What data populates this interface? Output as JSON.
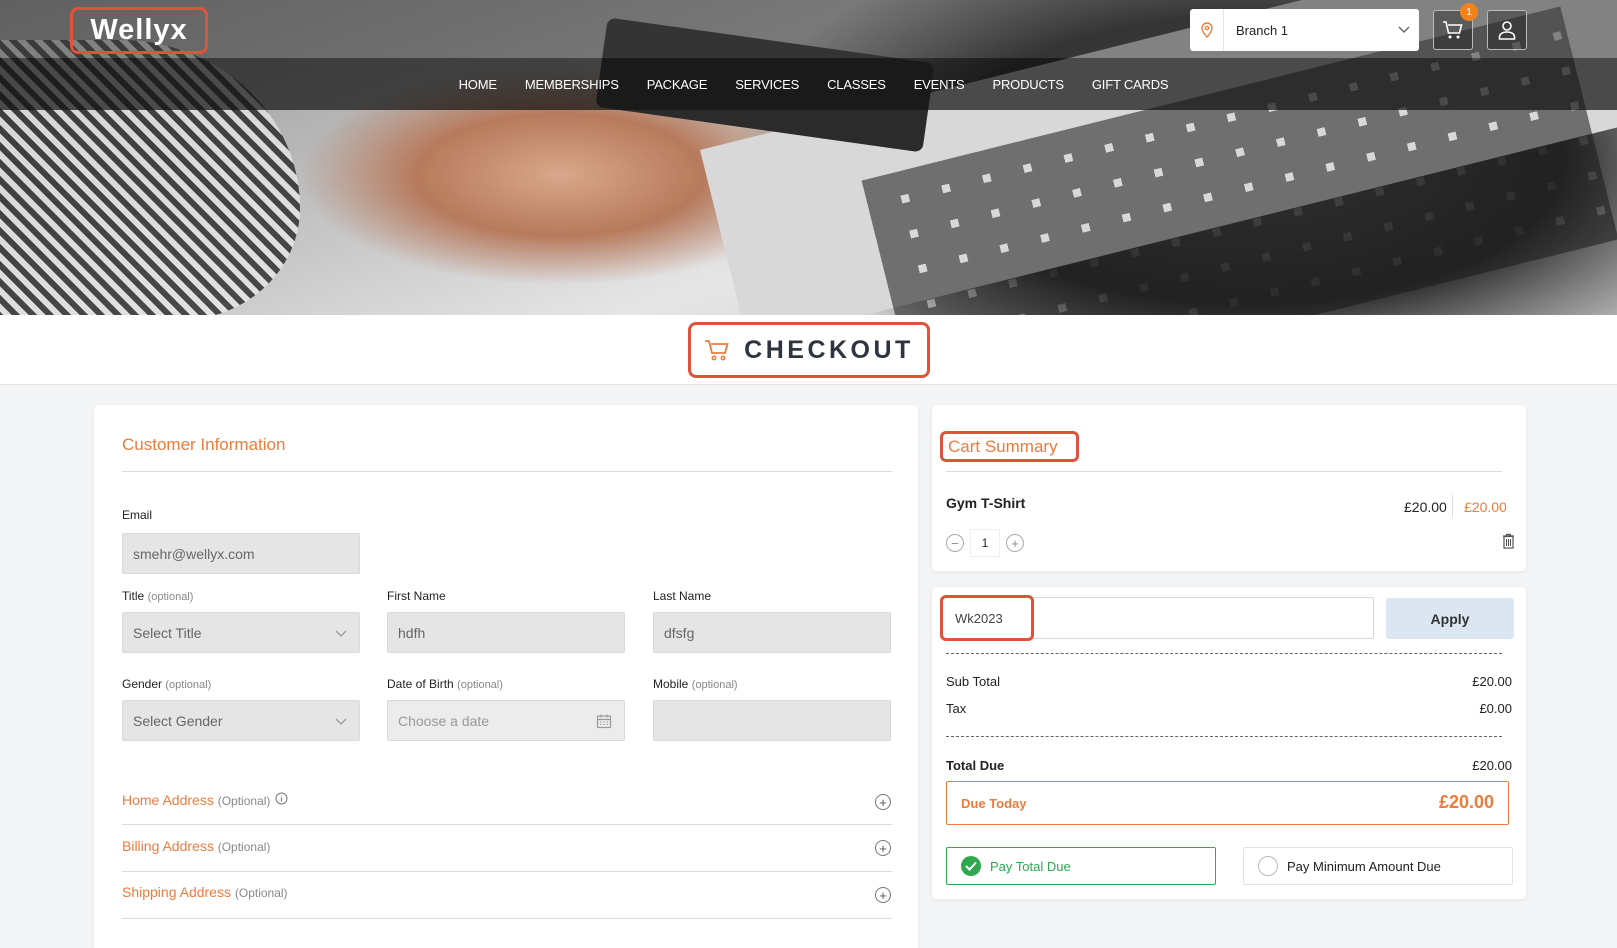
{
  "brand": {
    "logo": "Wellyx"
  },
  "header": {
    "branch": "Branch 1",
    "cart_count": "1",
    "nav": [
      "HOME",
      "MEMBERSHIPS",
      "PACKAGE",
      "SERVICES",
      "CLASSES",
      "EVENTS",
      "PRODUCTS",
      "GIFT CARDS"
    ]
  },
  "page": {
    "title": "CHECKOUT"
  },
  "customer": {
    "section_title": "Customer Information",
    "email_label": "Email",
    "email_value": "smehr@wellyx.com",
    "title_label": "Title",
    "title_opt": "(optional)",
    "title_value": "Select Title",
    "first_name_label": "First Name",
    "first_name_value": "hdfh",
    "last_name_label": "Last Name",
    "last_name_value": "dfsfg",
    "gender_label": "Gender",
    "gender_opt": "(optional)",
    "gender_value": "Select Gender",
    "dob_label": "Date of Birth",
    "dob_opt": "(optional)",
    "dob_placeholder": "Choose a date",
    "mobile_label": "Mobile",
    "mobile_opt": "(optional)",
    "mobile_value": ""
  },
  "addresses": [
    {
      "title": "Home Address",
      "opt": "(Optional)"
    },
    {
      "title": "Billing Address",
      "opt": "(Optional)"
    },
    {
      "title": "Shipping Address",
      "opt": "(Optional)"
    }
  ],
  "cart": {
    "title": "Cart Summary",
    "item": {
      "name": "Gym T-Shirt",
      "unit_price": "£20.00",
      "total": "£20.00",
      "qty": "1"
    }
  },
  "summary": {
    "coupon": "Wk2023",
    "apply_label": "Apply",
    "sub_total_label": "Sub Total",
    "sub_total": "£20.00",
    "tax_label": "Tax",
    "tax": "£0.00",
    "total_due_label": "Total Due",
    "total_due": "£20.00",
    "due_today_label": "Due Today",
    "due_today": "£20.00",
    "pay_total_label": "Pay Total Due",
    "pay_min_label": "Pay Minimum Amount Due"
  },
  "colors": {
    "accent": "#ef7b3a",
    "highlight": "#e0533a",
    "success": "#2fa84f"
  }
}
